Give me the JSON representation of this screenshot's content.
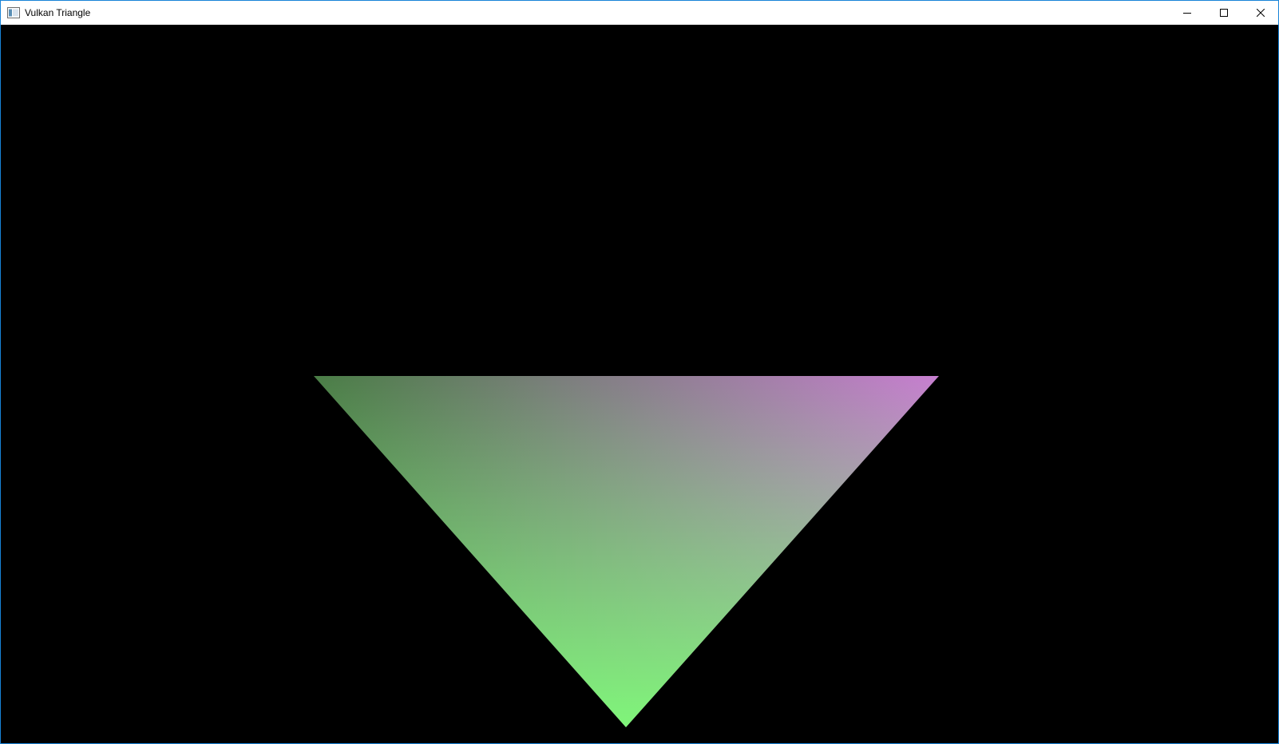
{
  "window": {
    "title": "Vulkan Triangle",
    "border_color": "#1883d7",
    "icon": "app-window-icon",
    "controls": {
      "minimize_icon": "minimize-icon",
      "maximize_icon": "maximize-icon",
      "close_icon": "close-icon"
    }
  },
  "scene": {
    "background_color": "#000000",
    "triangle": {
      "vertex_colors": {
        "top_left": "#4a7d46",
        "top_right": "#c77fd0",
        "bottom": "#80f57a"
      }
    }
  }
}
